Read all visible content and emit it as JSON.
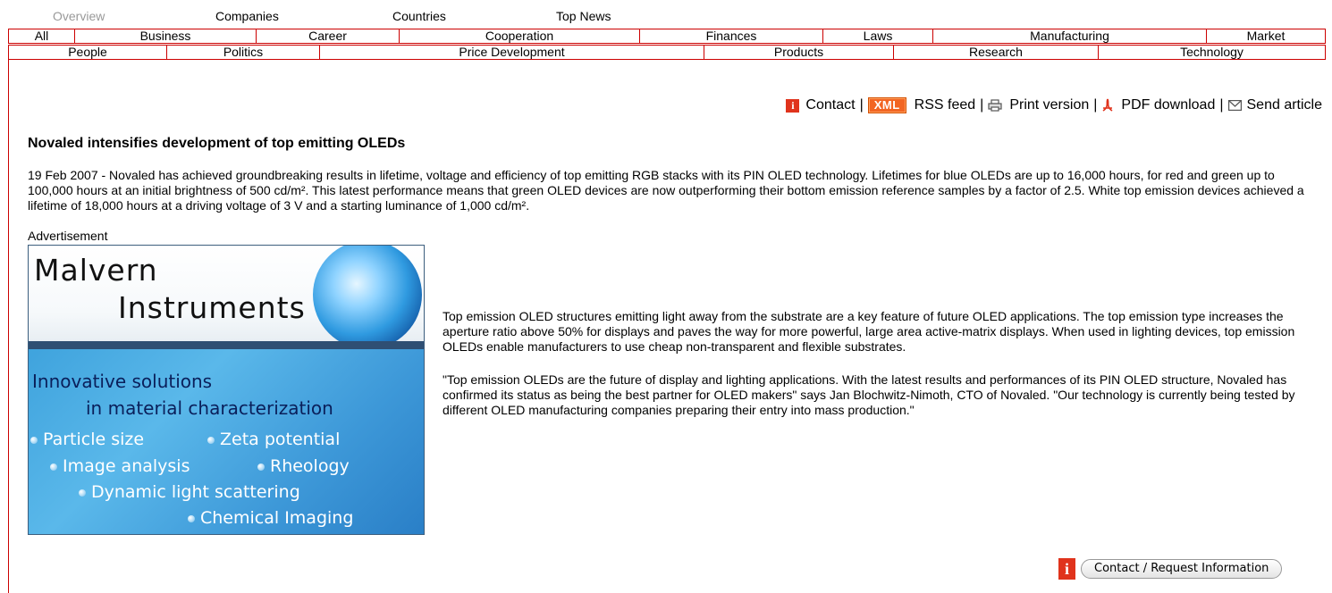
{
  "top_tabs": [
    "Overview",
    "Companies",
    "Countries",
    "Top News"
  ],
  "categories_row1": [
    "All",
    "Business",
    "Career",
    "Cooperation",
    "Finances",
    "Laws",
    "Manufacturing",
    "Market"
  ],
  "categories_row2": [
    "People",
    "Politics",
    "Price Development",
    "Products",
    "Research",
    "Technology"
  ],
  "tools": {
    "contact": "Contact",
    "xml_badge": "XML",
    "rss": "RSS feed",
    "print": "Print version",
    "pdf": "PDF download",
    "send": "Send article",
    "separator": "|"
  },
  "article": {
    "headline": "Novaled intensifies development of top emitting OLEDs",
    "intro": "19 Feb 2007 - Novaled has achieved groundbreaking results in lifetime, voltage and efficiency of top emitting RGB stacks with its PIN OLED technology. Lifetimes for blue OLEDs are up to 16,000 hours, for red and green up to 100,000 hours at an initial brightness of 500 cd/m². This latest performance means that green OLED devices are now outperforming their bottom emission reference samples by a factor of 2.5. White top emission devices achieved a lifetime of 18,000 hours at a driving voltage of 3 V and a starting luminance of 1,000 cd/m².",
    "paragraph1": "Top emission OLED structures emitting light away from the substrate are a key feature of future OLED applications. The top emission type increases the aperture ratio above 50% for displays and paves the way for more powerful, large area active-matrix displays. When used in lighting devices, top emission OLEDs enable manufacturers to use cheap non-transparent and flexible substrates.",
    "paragraph2": "\"Top emission OLEDs are the future of display and lighting applications. With the latest results and performances of its PIN OLED structure, Novaled has confirmed its status as being the best partner for OLED makers\" says Jan Blochwitz-Nimoth, CTO of Novaled. \"Our technology is currently being tested by different OLED manufacturing companies preparing their entry into mass production.\""
  },
  "advertisement": {
    "label": "Advertisement",
    "brand_line1": "Malvern",
    "brand_line2": "Instruments",
    "tagline1": "Innovative solutions",
    "tagline2": "in material characterization",
    "bullets": [
      "Particle size",
      "Zeta potential",
      "Image analysis",
      "Rheology",
      "Dynamic light scattering",
      "Chemical Imaging"
    ]
  },
  "request_button": "Contact / Request Information",
  "colors": {
    "border": "#cc0000",
    "info_icon": "#e0331c",
    "xml_badge": "#f26522",
    "inactive_tab": "#999999"
  }
}
